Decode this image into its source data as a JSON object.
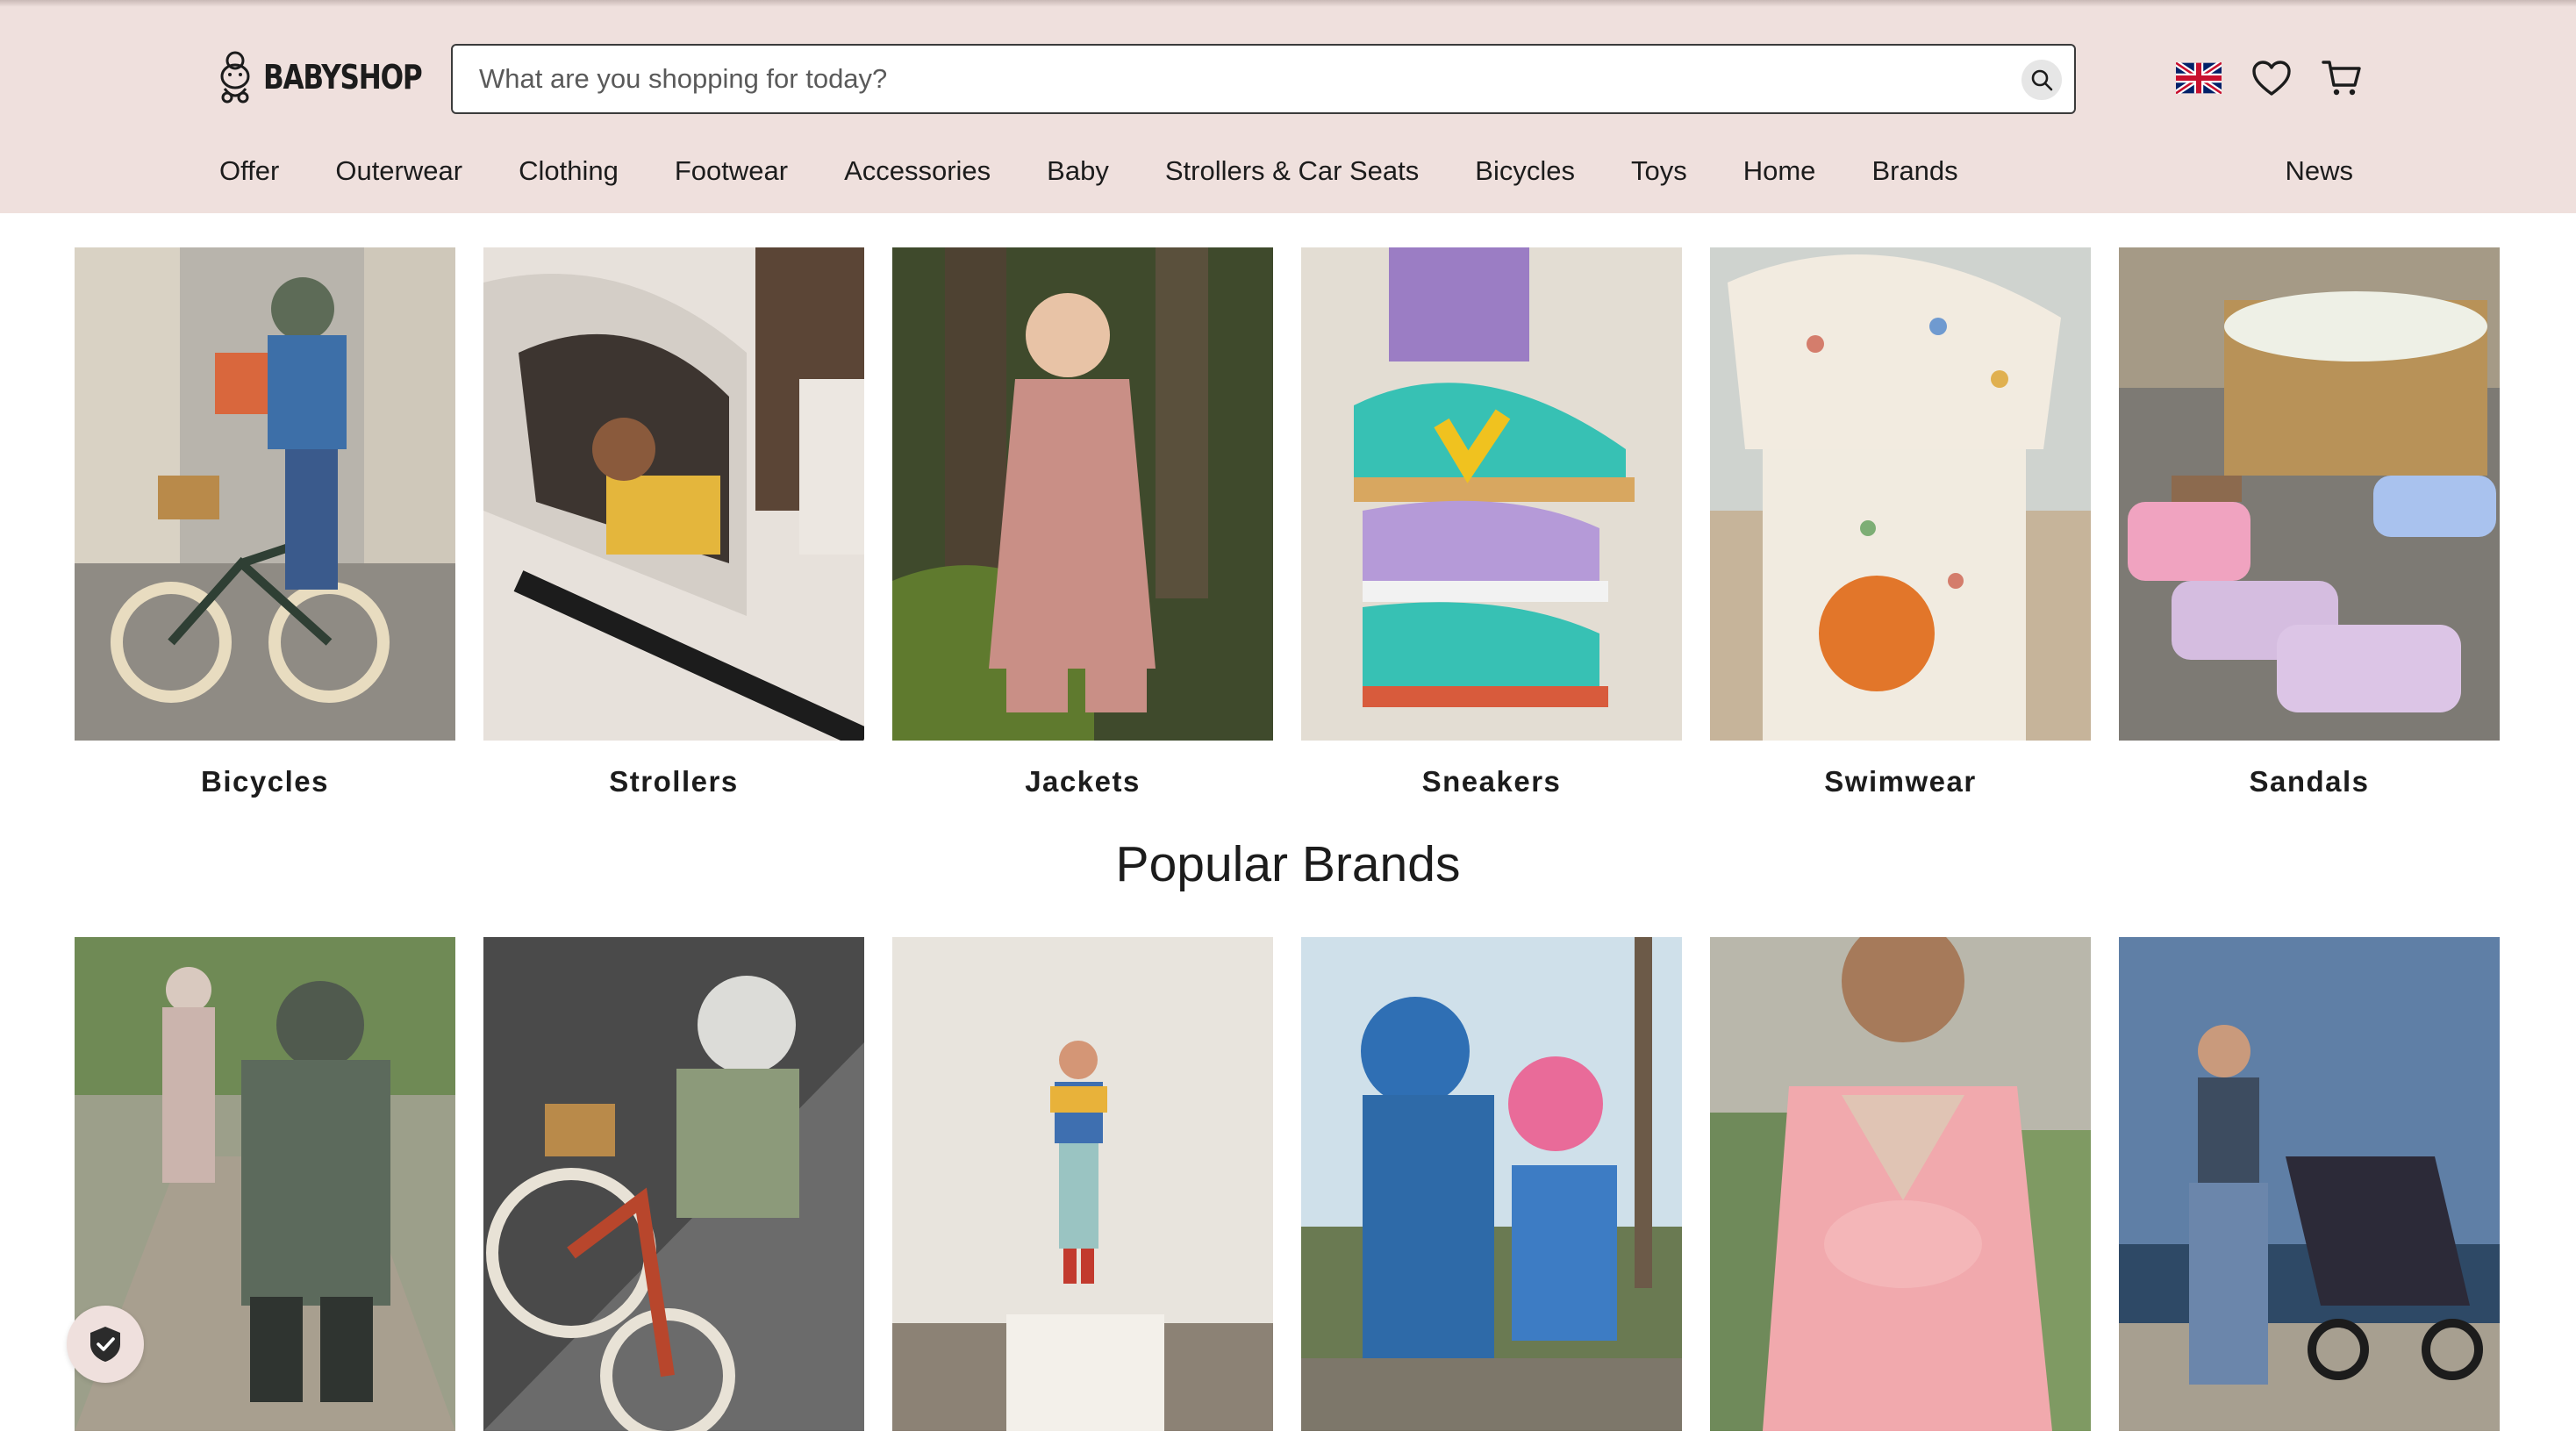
{
  "header": {
    "logo_text": "BABYSHOP",
    "search_placeholder": "What are you shopping for today?",
    "icons": [
      "uk-flag-icon",
      "heart-icon",
      "cart-icon",
      "search-icon"
    ]
  },
  "nav": {
    "items": [
      {
        "label": "Offer"
      },
      {
        "label": "Outerwear"
      },
      {
        "label": "Clothing"
      },
      {
        "label": "Footwear"
      },
      {
        "label": "Accessories"
      },
      {
        "label": "Baby"
      },
      {
        "label": "Strollers & Car Seats"
      },
      {
        "label": "Bicycles"
      },
      {
        "label": "Toys"
      },
      {
        "label": "Home"
      },
      {
        "label": "Brands"
      }
    ],
    "news_label": "News"
  },
  "categories": [
    {
      "label": "Bicycles"
    },
    {
      "label": "Strollers"
    },
    {
      "label": "Jackets"
    },
    {
      "label": "Sneakers"
    },
    {
      "label": "Swimwear"
    },
    {
      "label": "Sandals"
    }
  ],
  "brands_section": {
    "title": "Popular Brands"
  },
  "colors": {
    "header_bg": "#efe0dd",
    "text": "#1c1c1c"
  }
}
